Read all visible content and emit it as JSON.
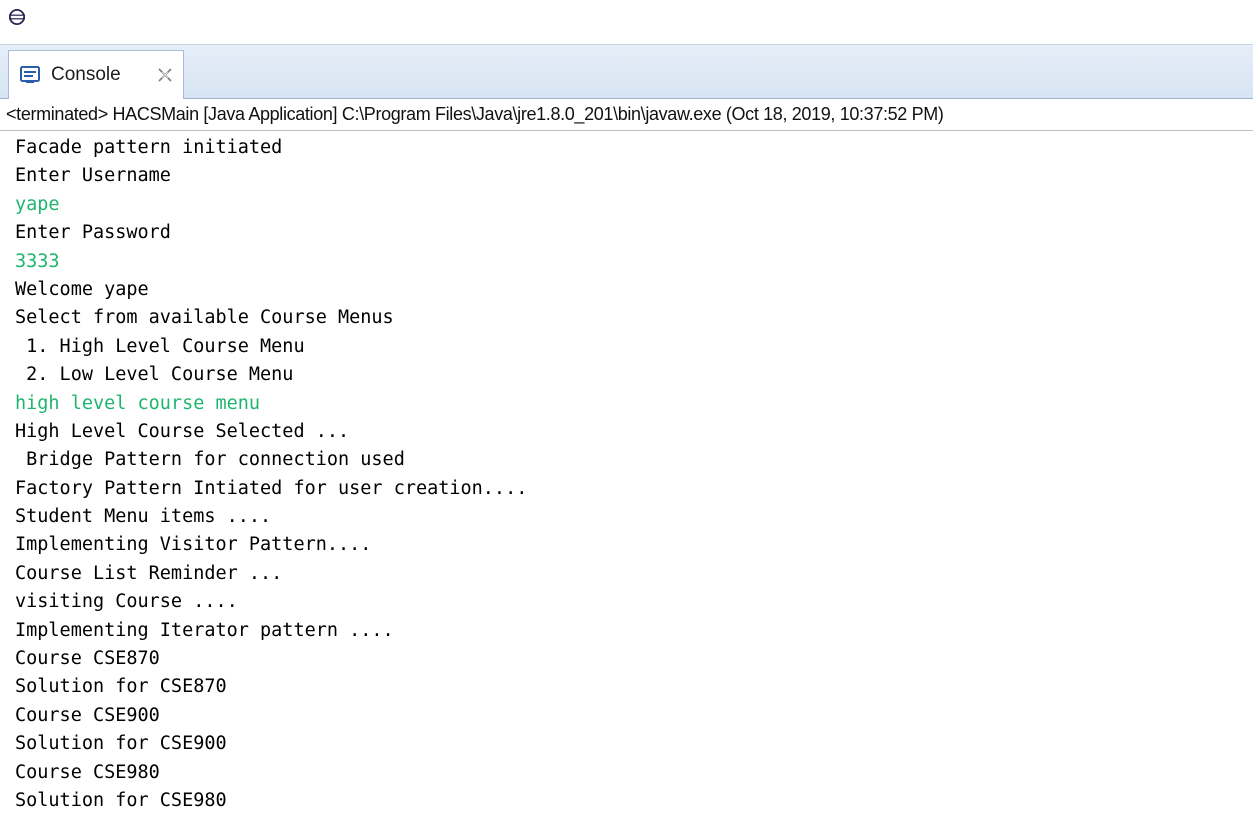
{
  "colors": {
    "stdout": "#000000",
    "stdin": "#1fb56f",
    "tab_bar": "#dbe6f4"
  },
  "icons": {
    "app": "eclipse-icon",
    "console": "console-icon",
    "close": "close-icon"
  },
  "tab": {
    "label": "Console"
  },
  "status": {
    "text": "<terminated> HACSMain [Java Application] C:\\Program Files\\Java\\jre1.8.0_201\\bin\\javaw.exe (Oct 18, 2019, 10:37:52 PM)"
  },
  "console": {
    "lines": [
      {
        "text": "Facade pattern initiated",
        "kind": "stdout"
      },
      {
        "text": "Enter Username",
        "kind": "stdout"
      },
      {
        "text": "yape",
        "kind": "stdin"
      },
      {
        "text": "Enter Password",
        "kind": "stdout"
      },
      {
        "text": "3333",
        "kind": "stdin"
      },
      {
        "text": "Welcome yape",
        "kind": "stdout"
      },
      {
        "text": "Select from available Course Menus",
        "kind": "stdout"
      },
      {
        "text": " 1. High Level Course Menu",
        "kind": "stdout"
      },
      {
        "text": " 2. Low Level Course Menu",
        "kind": "stdout"
      },
      {
        "text": "high level course menu",
        "kind": "stdin"
      },
      {
        "text": "High Level Course Selected ...",
        "kind": "stdout"
      },
      {
        "text": " Bridge Pattern for connection used",
        "kind": "stdout"
      },
      {
        "text": "Factory Pattern Intiated for user creation....",
        "kind": "stdout"
      },
      {
        "text": "Student Menu items ....",
        "kind": "stdout"
      },
      {
        "text": "Implementing Visitor Pattern....",
        "kind": "stdout"
      },
      {
        "text": "Course List Reminder ...",
        "kind": "stdout"
      },
      {
        "text": "visiting Course ....",
        "kind": "stdout"
      },
      {
        "text": "Implementing Iterator pattern ....",
        "kind": "stdout"
      },
      {
        "text": "Course CSE870",
        "kind": "stdout"
      },
      {
        "text": "Solution for CSE870",
        "kind": "stdout"
      },
      {
        "text": "Course CSE900",
        "kind": "stdout"
      },
      {
        "text": "Solution for CSE900",
        "kind": "stdout"
      },
      {
        "text": "Course CSE980",
        "kind": "stdout"
      },
      {
        "text": "Solution for CSE980",
        "kind": "stdout"
      }
    ]
  }
}
